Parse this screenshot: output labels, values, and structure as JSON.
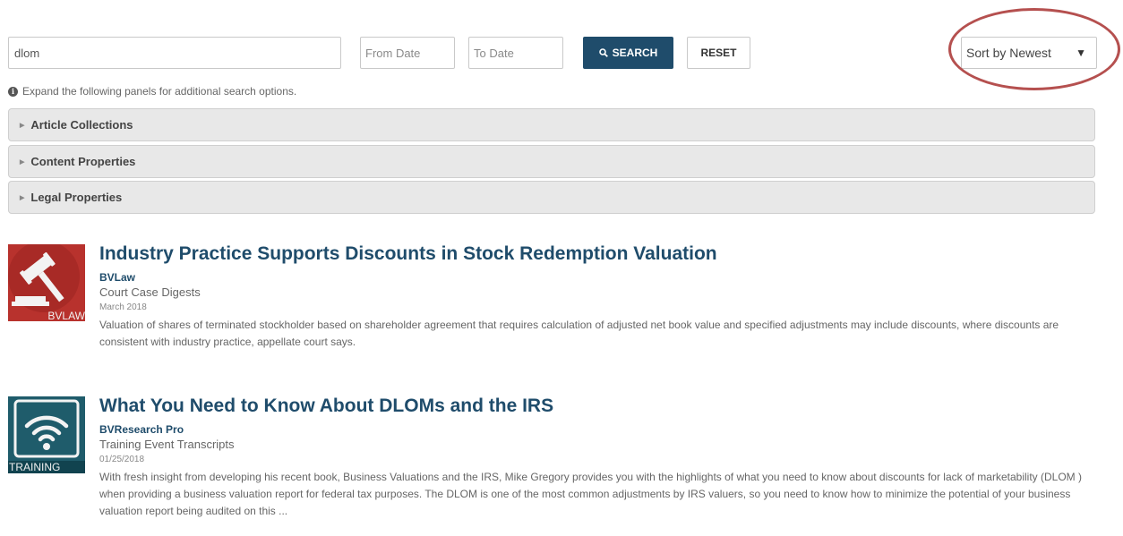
{
  "search": {
    "query": "dlom",
    "from_date_placeholder": "From Date",
    "to_date_placeholder": "To Date",
    "search_label": "SEARCH",
    "reset_label": "RESET"
  },
  "sort": {
    "selected": "Sort by Newest",
    "arrow": "▼"
  },
  "hint": "Expand the following panels for additional search options.",
  "panels": [
    {
      "label": "Article Collections"
    },
    {
      "label": "Content Properties"
    },
    {
      "label": "Legal Properties"
    }
  ],
  "results": [
    {
      "title": "Industry Practice Supports Discounts in Stock Redemption Valuation",
      "source": "BVLaw",
      "category": "Court Case Digests",
      "date": "March 2018",
      "description": "Valuation of shares of terminated stockholder based on shareholder agreement that requires calculation of adjusted net book value and specified adjustments may include discounts, where discounts are consistent with industry practice, appellate court says.",
      "thumb_label": "BVLAW",
      "thumb_icon": "gavel-icon"
    },
    {
      "title": "What You Need to Know About DLOMs and the IRS",
      "source": "BVResearch Pro",
      "category": "Training Event Transcripts",
      "date": "01/25/2018",
      "description": "With fresh insight from developing his recent book, Business Valuations and the IRS, Mike Gregory provides you with the highlights of what you need to know about discounts for lack of marketability (DLOM ) when providing a business valuation report for federal tax purposes. The DLOM is one of the most common adjustments by IRS valuers, so you need to know how to minimize the potential of your business valuation report being audited on this ...",
      "thumb_label": "TRAINING",
      "thumb_icon": "wifi-icon"
    }
  ],
  "colors": {
    "brand_navy": "#1f4c6b",
    "highlight_ring": "#b5504f",
    "law_thumb": "#b8322d",
    "training_thumb": "#1f5c6b"
  }
}
